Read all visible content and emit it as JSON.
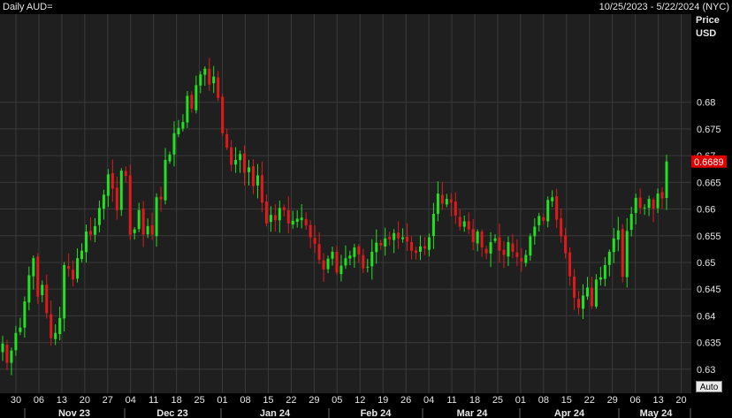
{
  "header": {
    "title": "Daily AUD=",
    "date_range": "10/25/2023 - 5/22/2024 (NYC)"
  },
  "axis": {
    "price_label": "Price",
    "currency_label": "USD",
    "auto_button": "Auto"
  },
  "colors": {
    "background": "#1f1f1f",
    "grid": "#3a3a3a",
    "up": "#22e022",
    "down": "#e01a1a",
    "last_price_badge": "#e00000",
    "text": "#e6e6e6"
  },
  "chart_data": {
    "type": "candlestick",
    "title": "Daily AUD=",
    "date_range": "10/25/2023 - 5/22/2024 (NYC)",
    "ylabel": "Price USD",
    "ylim": [
      0.6255,
      0.6965
    ],
    "y_ticks": [
      0.63,
      0.635,
      0.64,
      0.645,
      0.65,
      0.655,
      0.66,
      0.665,
      0.67,
      0.675,
      0.68
    ],
    "last_price": "0.6689",
    "day_ticks": [
      "30",
      "06",
      "13",
      "20",
      "27",
      "04",
      "11",
      "18",
      "25",
      "01",
      "08",
      "15",
      "22",
      "29",
      "05",
      "12",
      "19",
      "26",
      "04",
      "11",
      "18",
      "25",
      "01",
      "08",
      "15",
      "22",
      "29",
      "06",
      "13",
      "20"
    ],
    "month_labels": [
      "Nov 23",
      "Dec 23",
      "Jan 24",
      "Feb 24",
      "Mar 24",
      "Apr 24",
      "May 24"
    ],
    "closes": [
      0.6348,
      0.6312,
      0.6335,
      0.6368,
      0.6378,
      0.6427,
      0.6476,
      0.6508,
      0.6436,
      0.6458,
      0.6405,
      0.6358,
      0.6368,
      0.6396,
      0.6495,
      0.6488,
      0.6468,
      0.6508,
      0.6522,
      0.6558,
      0.6552,
      0.6568,
      0.6602,
      0.6627,
      0.6665,
      0.6638,
      0.6598,
      0.6672,
      0.6662,
      0.6552,
      0.6562,
      0.6598,
      0.6552,
      0.6568,
      0.6552,
      0.6622,
      0.6618,
      0.6692,
      0.6702,
      0.6742,
      0.6752,
      0.6763,
      0.6812,
      0.6788,
      0.6832,
      0.6852,
      0.6863,
      0.6833,
      0.6848,
      0.6808,
      0.6742,
      0.6715,
      0.6683,
      0.6692,
      0.6703,
      0.6668,
      0.6678,
      0.6643,
      0.6663,
      0.6612,
      0.6573,
      0.6589,
      0.6579,
      0.6602,
      0.6598,
      0.6573,
      0.6578,
      0.6582,
      0.6584,
      0.6569,
      0.6547,
      0.6535,
      0.6505,
      0.6487,
      0.6507,
      0.652,
      0.6481,
      0.6494,
      0.6508,
      0.6513,
      0.6528,
      0.6515,
      0.6489,
      0.6492,
      0.652,
      0.6537,
      0.6532,
      0.6545,
      0.6543,
      0.6555,
      0.6545,
      0.6547,
      0.6539,
      0.6522,
      0.6518,
      0.653,
      0.6526,
      0.6547,
      0.6591,
      0.6629,
      0.661,
      0.6619,
      0.6612,
      0.6588,
      0.6567,
      0.6577,
      0.6562,
      0.6538,
      0.6558,
      0.6528,
      0.6517,
      0.6538,
      0.6545,
      0.6522,
      0.6514,
      0.6538,
      0.652,
      0.651,
      0.6502,
      0.6514,
      0.6549,
      0.6567,
      0.6587,
      0.6578,
      0.6617,
      0.6622,
      0.658,
      0.6549,
      0.6517,
      0.6474,
      0.6434,
      0.6415,
      0.6438,
      0.6453,
      0.6418,
      0.6468,
      0.6472,
      0.6495,
      0.652,
      0.6545,
      0.656,
      0.6473,
      0.6559,
      0.6591,
      0.6621,
      0.6602,
      0.6603,
      0.6619,
      0.6601,
      0.6629,
      0.662,
      0.6689
    ]
  }
}
